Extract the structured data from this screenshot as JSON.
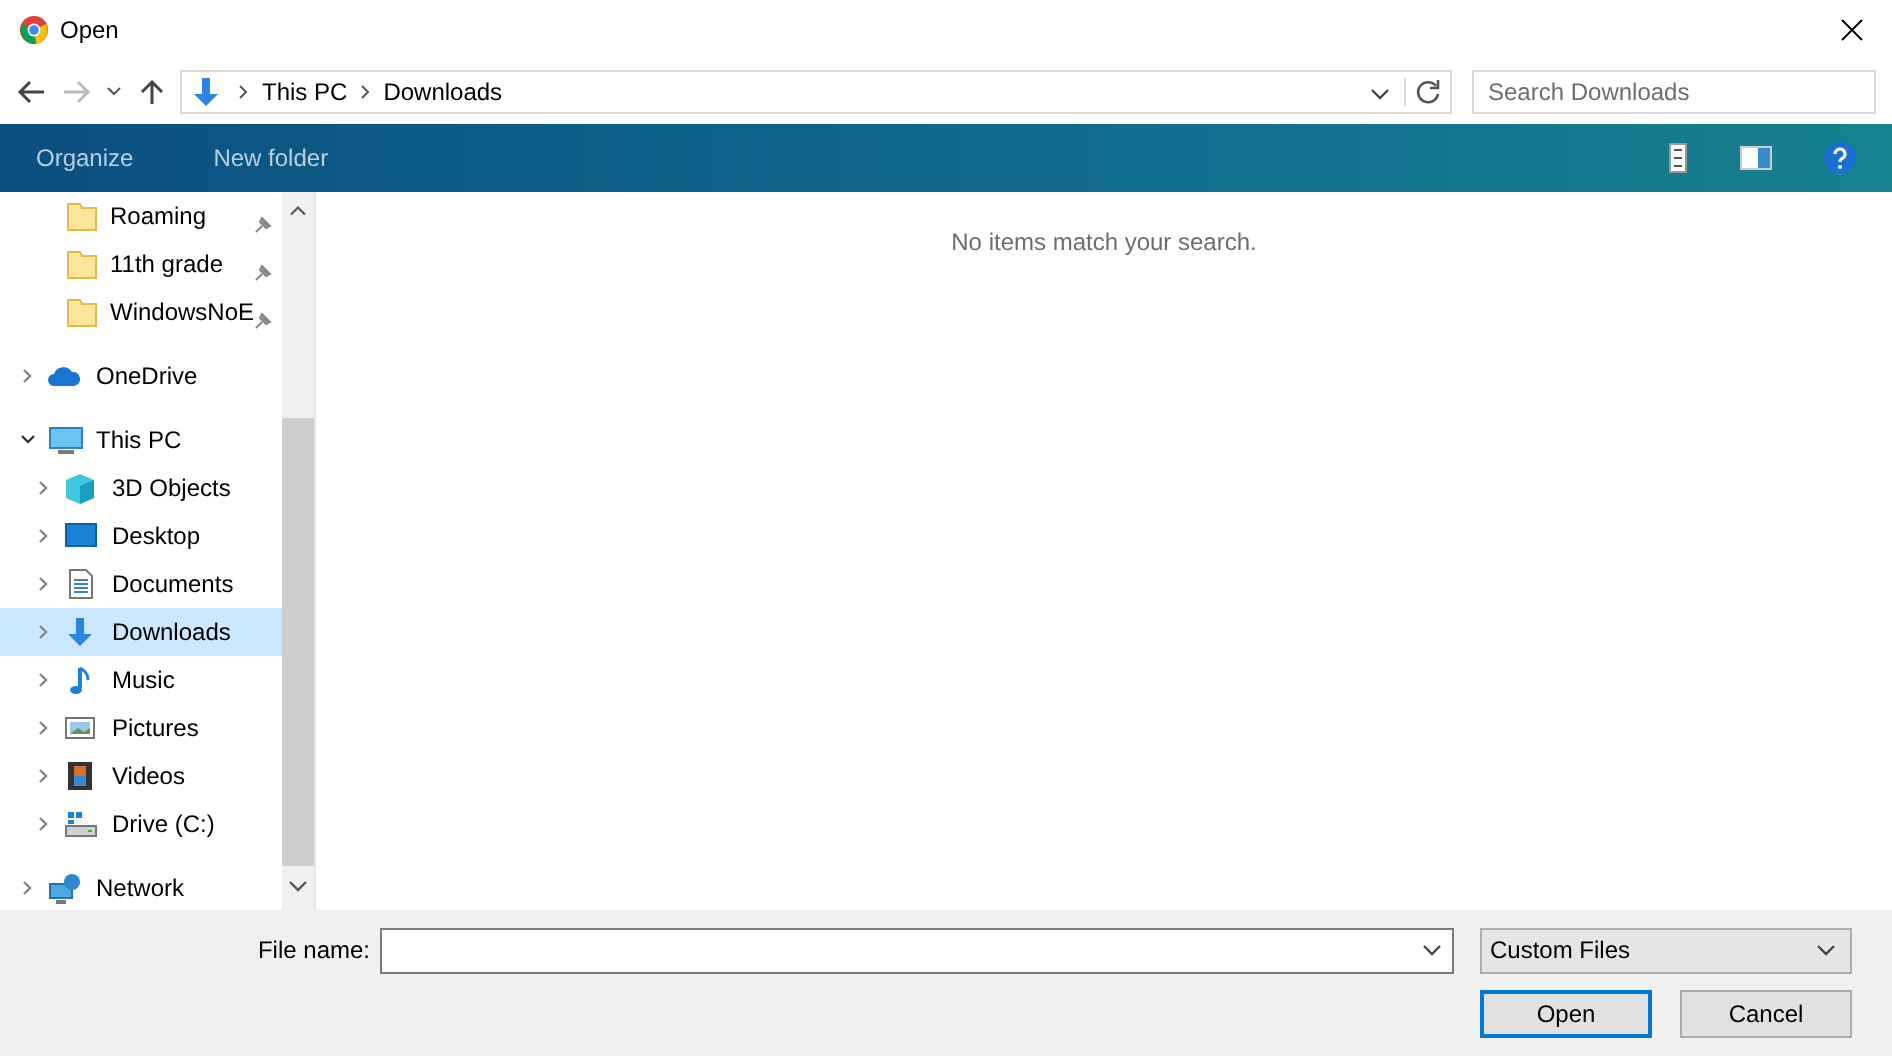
{
  "window": {
    "title": "Open"
  },
  "address": {
    "crumbs": [
      "This PC",
      "Downloads"
    ]
  },
  "search": {
    "placeholder": "Search Downloads"
  },
  "toolbar": {
    "buttons": [
      "Organize",
      "New folder"
    ]
  },
  "quick_access_items": [
    {
      "label": "Roaming",
      "pinned": true,
      "selected": false
    },
    {
      "label": "11th grade",
      "pinned": true,
      "selected": false
    },
    {
      "label": "WindowsNoE",
      "pinned": true,
      "selected": false
    }
  ],
  "tree": [
    {
      "label": "OneDrive",
      "kind": "cloud",
      "expanded": false,
      "selected": false
    },
    {
      "label": "This PC",
      "kind": "pc",
      "expanded": true,
      "selected": false,
      "children": [
        {
          "label": "3D Objects",
          "kind": "cube",
          "expanded": false,
          "selected": false
        },
        {
          "label": "Desktop",
          "kind": "desktop",
          "expanded": false,
          "selected": false
        },
        {
          "label": "Documents",
          "kind": "document",
          "expanded": false,
          "selected": false
        },
        {
          "label": "Downloads",
          "kind": "download",
          "expanded": false,
          "selected": true
        },
        {
          "label": "Music",
          "kind": "music",
          "expanded": false,
          "selected": false
        },
        {
          "label": "Pictures",
          "kind": "picture",
          "expanded": false,
          "selected": false
        },
        {
          "label": "Videos",
          "kind": "video",
          "expanded": false,
          "selected": false
        },
        {
          "label": "Drive (C:)",
          "kind": "drive",
          "expanded": false,
          "selected": false
        }
      ]
    },
    {
      "label": "Network",
      "kind": "network",
      "expanded": false,
      "selected": false
    }
  ],
  "content": {
    "message": "No items match your search."
  },
  "footer": {
    "file_name_label": "File name:",
    "file_type": "Custom Files",
    "buttons": [
      "Open",
      "Cancel"
    ]
  }
}
